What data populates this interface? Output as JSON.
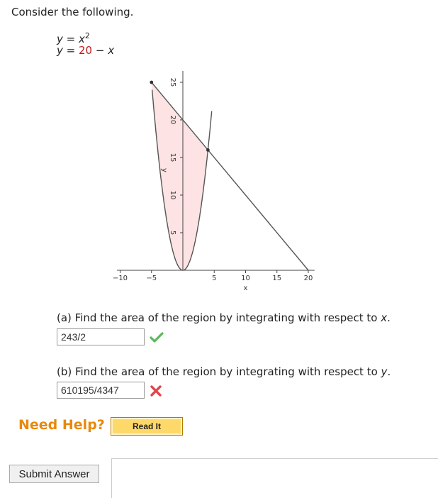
{
  "intro": "Consider the following.",
  "equations": {
    "eq1_lhs": "y",
    "eq1_eq": " = ",
    "eq1_rhs_base": "x",
    "eq1_rhs_exp": "2",
    "eq2_lhs": "y",
    "eq2_eq": " = ",
    "eq2_const": "20",
    "eq2_minus": " − ",
    "eq2_var": "x"
  },
  "chart_data": {
    "type": "line",
    "series": [
      {
        "expression": "y = x^2",
        "x_range": [
          -4.9,
          4.6
        ]
      },
      {
        "expression": "y = 20 - x",
        "x_range": [
          -5.0,
          20.0
        ]
      }
    ],
    "shaded_region": {
      "between": [
        "y = 20 - x",
        "y = x^2"
      ],
      "x_range": [
        -5,
        4
      ],
      "color": "#fde3e3"
    },
    "intersection_points": [
      [
        -5,
        25
      ],
      [
        4,
        16
      ]
    ],
    "x_ticks": [
      -10,
      -5,
      5,
      10,
      15,
      20
    ],
    "x_tick_labels": [
      "−10",
      "−5",
      "5",
      "10",
      "15",
      "20"
    ],
    "y_ticks": [
      5,
      10,
      15,
      20,
      25
    ],
    "y_tick_labels": [
      "5",
      "10",
      "15",
      "20",
      "25"
    ],
    "xlabel": "x",
    "ylabel": "y",
    "xlim": [
      -10.5,
      21
    ],
    "ylim": [
      0,
      27
    ],
    "grid": false
  },
  "question_a": {
    "prefix": "(a) Find the area of the region by integrating with respect to ",
    "var": "x",
    "suffix": ".",
    "answer": "243/2",
    "status": "correct",
    "check_color": "#5cb85c"
  },
  "question_b": {
    "prefix": "(b) Find the area of the region by integrating with respect to ",
    "var": "y",
    "suffix": ".",
    "answer": "610195/4347",
    "status": "incorrect",
    "x_color": "#e0474c"
  },
  "help": {
    "label": "Need Help?",
    "read_it": "Read It"
  },
  "submit_label": "Submit Answer"
}
